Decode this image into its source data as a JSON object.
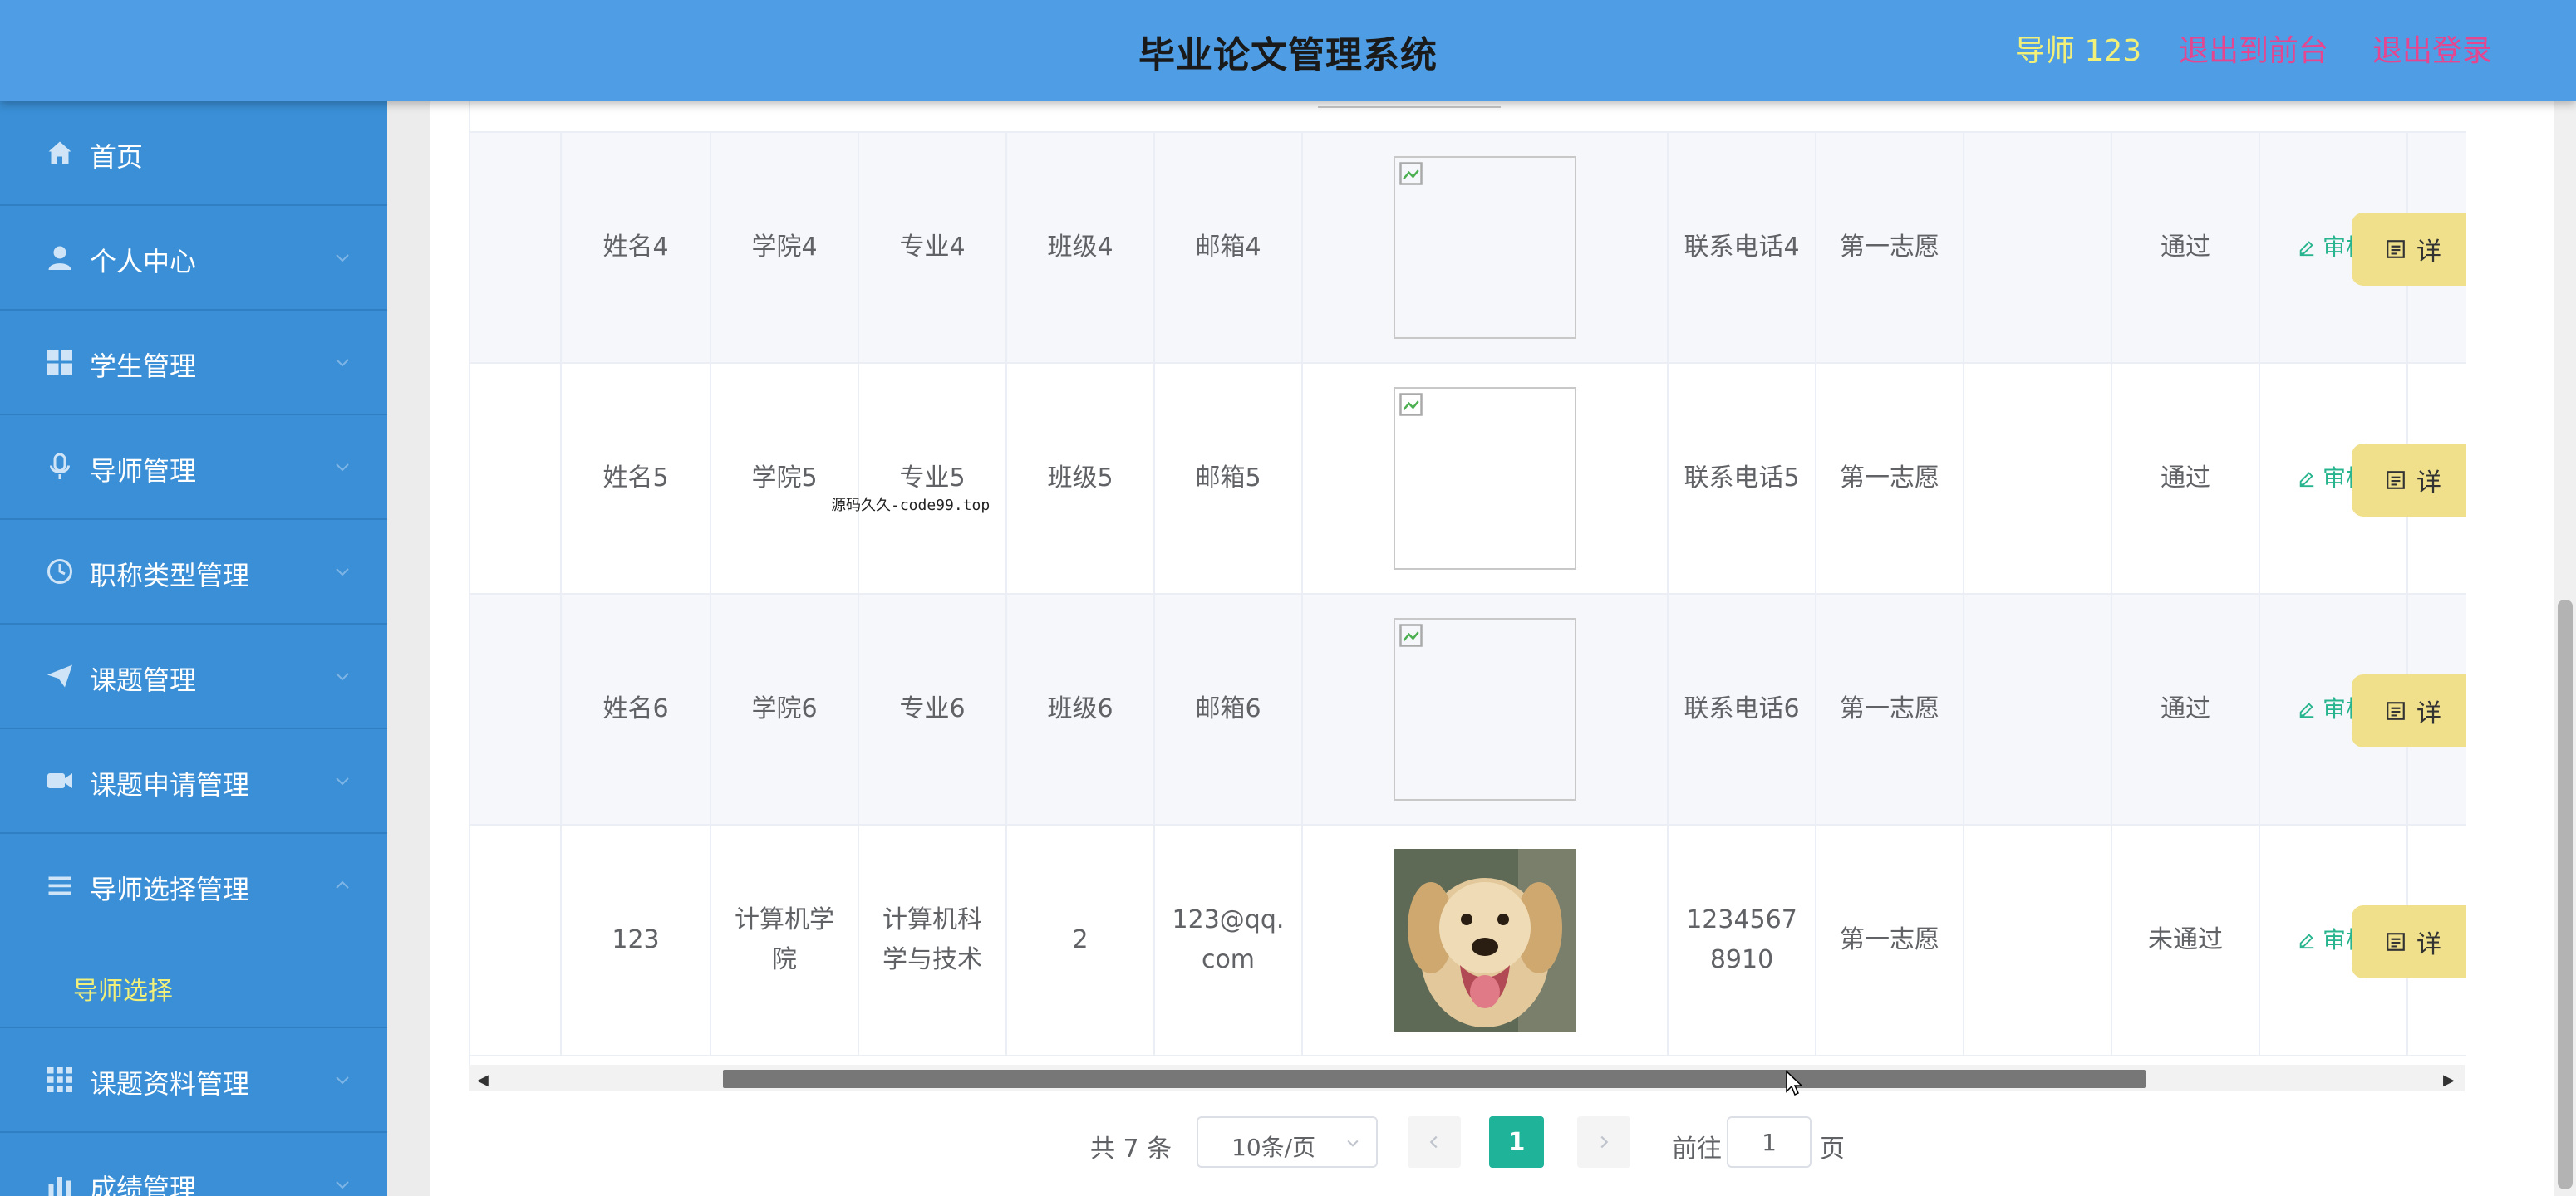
{
  "header": {
    "title": "毕业论文管理系统",
    "user": "导师 123",
    "front": "退出到前台",
    "logout": "退出登录"
  },
  "sidebar": {
    "items": [
      {
        "label": "首页",
        "icon": "home-icon"
      },
      {
        "label": "个人中心",
        "icon": "user-icon"
      },
      {
        "label": "学生管理",
        "icon": "grid-icon"
      },
      {
        "label": "导师管理",
        "icon": "microphone-icon"
      },
      {
        "label": "职称类型管理",
        "icon": "clock-icon"
      },
      {
        "label": "课题管理",
        "icon": "send-icon"
      },
      {
        "label": "课题申请管理",
        "icon": "video-icon"
      },
      {
        "label": "导师选择管理",
        "icon": "list-icon"
      },
      {
        "label": "课题资料管理",
        "icon": "grid-icon"
      },
      {
        "label": "成绩管理",
        "icon": "chart-icon"
      }
    ],
    "submenu": {
      "label": "导师选择"
    }
  },
  "table": {
    "rows": [
      {
        "name": "姓名4",
        "college": "学院4",
        "major": "专业4",
        "class": "班级4",
        "email": "邮箱4",
        "photo": "broken",
        "phone": "联系电话4",
        "choice": "第一志愿",
        "status": "通过",
        "review": "审核",
        "detail": "详"
      },
      {
        "name": "姓名5",
        "college": "学院5",
        "major": "专业5",
        "class": "班级5",
        "email": "邮箱5",
        "photo": "broken",
        "phone": "联系电话5",
        "choice": "第一志愿",
        "status": "通过",
        "review": "审核",
        "detail": "详"
      },
      {
        "name": "姓名6",
        "college": "学院6",
        "major": "专业6",
        "class": "班级6",
        "email": "邮箱6",
        "photo": "broken",
        "phone": "联系电话6",
        "choice": "第一志愿",
        "status": "通过",
        "review": "审核",
        "detail": "详"
      },
      {
        "name": "123",
        "college": "计算机学院",
        "major": "计算机科学与技术",
        "class": "2",
        "email": "123@qq.com",
        "photo": "dog",
        "phone": "12345678910",
        "choice": "第一志愿",
        "status": "未通过",
        "review": "审核",
        "detail": "详"
      }
    ]
  },
  "pagination": {
    "total": "共 7 条",
    "page_size": "10条/页",
    "current": "1",
    "goto_label": "前往",
    "goto_value": "1",
    "page_suffix": "页"
  },
  "watermark": "源码久久-code99.top",
  "colors": {
    "header_bg": "#4f9ee5",
    "sidebar_bg": "#3a8fd6",
    "accent": "#1fb39a",
    "user_name": "#f3f07a",
    "header_links": "#e6458f"
  }
}
